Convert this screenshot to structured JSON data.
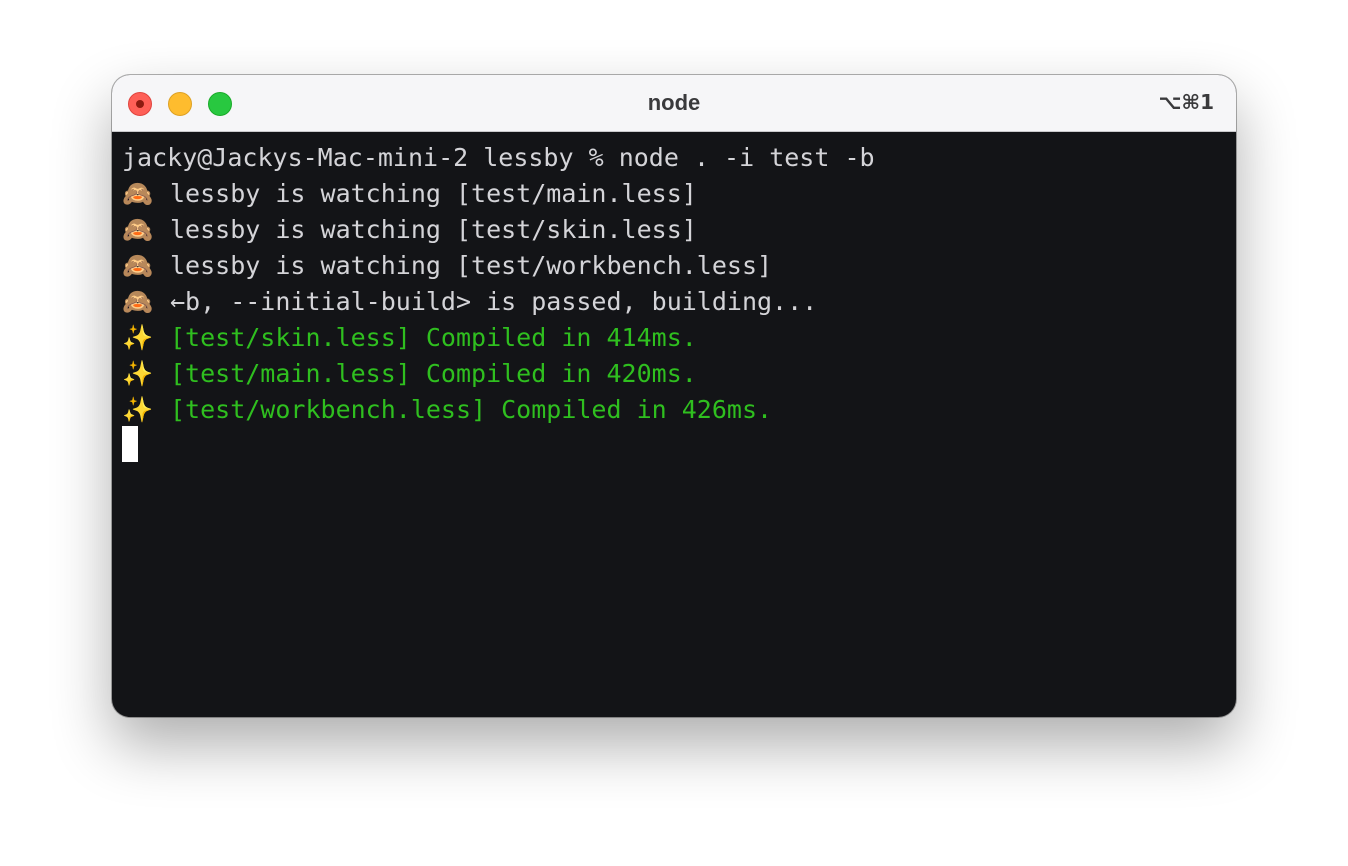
{
  "window": {
    "title": "node",
    "shortcut": "⌥⌘1"
  },
  "colors": {
    "terminal_background": "#131417",
    "output_text": "#d4d4d8",
    "success_text": "#2fbf1f",
    "titlebar": "#f6f6f8"
  },
  "terminal": {
    "prompt_line": "jacky@Jackys-Mac-mini-2 lessby % node . -i test -b",
    "icons": {
      "monkey": "see-no-evil-monkey-icon",
      "sparkles": "sparkles-icon"
    },
    "emoji": {
      "monkey": "🙈",
      "sparkles": "✨"
    },
    "watch_lines": [
      "lessby is watching [test/main.less]",
      "lessby is watching [test/skin.less]",
      "lessby is watching [test/workbench.less]"
    ],
    "build_line": "←b, --initial-build> is passed, building...",
    "compiled_lines": [
      "[test/skin.less] Compiled in 414ms.",
      "[test/main.less] Compiled in 420ms.",
      "[test/workbench.less] Compiled in 426ms."
    ]
  }
}
